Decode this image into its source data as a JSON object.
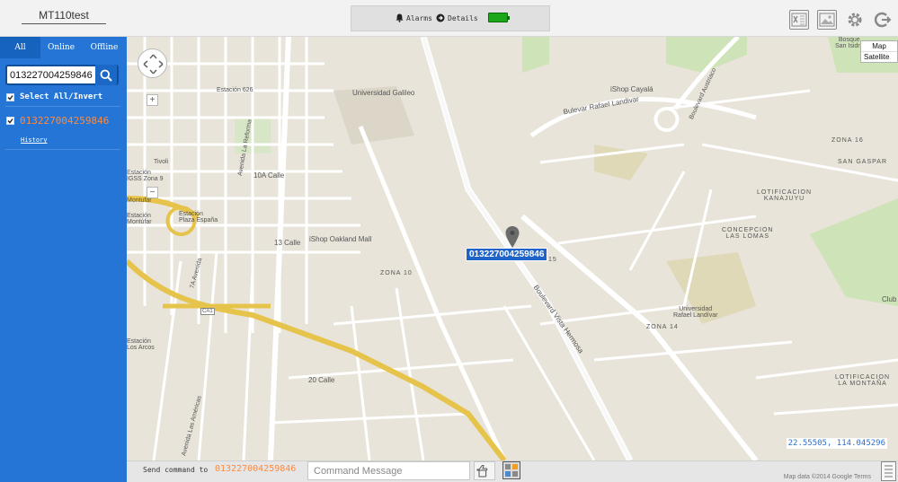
{
  "app": {
    "device_title": "MT110test"
  },
  "header": {
    "alarms_label": "Alarms",
    "details_label": "Details",
    "battery_color": "#1aa81a",
    "right_icons": [
      "excel-export-icon",
      "image-icon",
      "settings-gear-icon",
      "logout-icon"
    ]
  },
  "sidebar": {
    "tabs": [
      {
        "label": "All",
        "active": true
      },
      {
        "label": "Online",
        "active": false
      },
      {
        "label": "Offline",
        "active": false
      }
    ],
    "search": {
      "value": "013227004259846"
    },
    "select_all_label": "Select All/Invert",
    "devices": [
      {
        "imei": "013227004259846",
        "checked": true,
        "history_label": "History"
      }
    ],
    "accent_color": "#2575d6",
    "device_color": "#ff8a3c"
  },
  "map": {
    "type_options": [
      "Map",
      "Satellite"
    ],
    "marker_label": "013227004259846",
    "coordinates": "22.55505, 114.045296",
    "attribution": "Map data ©2014 Google  Terms",
    "labels": [
      {
        "text": "Bosque\nSan Isidro"
      },
      {
        "text": "Universidad Galileo"
      },
      {
        "text": "iShop Cayalá"
      },
      {
        "text": "Bulevar Rafael Landivar"
      },
      {
        "text": "Boulevard Austriaco"
      },
      {
        "text": "Estación 626"
      },
      {
        "text": "ZONA 16"
      },
      {
        "text": "SAN GASPAR"
      },
      {
        "text": "LOTIFICACION\nKANAJUYU"
      },
      {
        "text": "CONCEPCION\nLAS LOMAS"
      },
      {
        "text": "Estación\nIGSS Zona 9"
      },
      {
        "text": "Estación\nPlaza España"
      },
      {
        "text": "Estación\nMontúfar"
      },
      {
        "text": "iShop Oakland Mall"
      },
      {
        "text": "ZONA 10"
      },
      {
        "text": "ZONA 15"
      },
      {
        "text": "Universidad\nRafael Landívar"
      },
      {
        "text": "Boulevard Vista Hermosa"
      },
      {
        "text": "ZONA 14"
      },
      {
        "text": "LOTIFICACION\nLA MONTAÑA"
      },
      {
        "text": "Estación\nLos Arcos"
      },
      {
        "text": "20 Calle"
      },
      {
        "text": "13 Calle"
      },
      {
        "text": "10A Calle"
      },
      {
        "text": "7A Avenida"
      },
      {
        "text": "Avenida La Reforma"
      },
      {
        "text": "Avenida Las Américas"
      },
      {
        "text": "CA1"
      },
      {
        "text": "Club"
      },
      {
        "text": "Tivoli"
      },
      {
        "text": "Montufar"
      }
    ]
  },
  "command_bar": {
    "prefix": "Send command to",
    "device": "013227004259846",
    "placeholder": "Command Message"
  }
}
